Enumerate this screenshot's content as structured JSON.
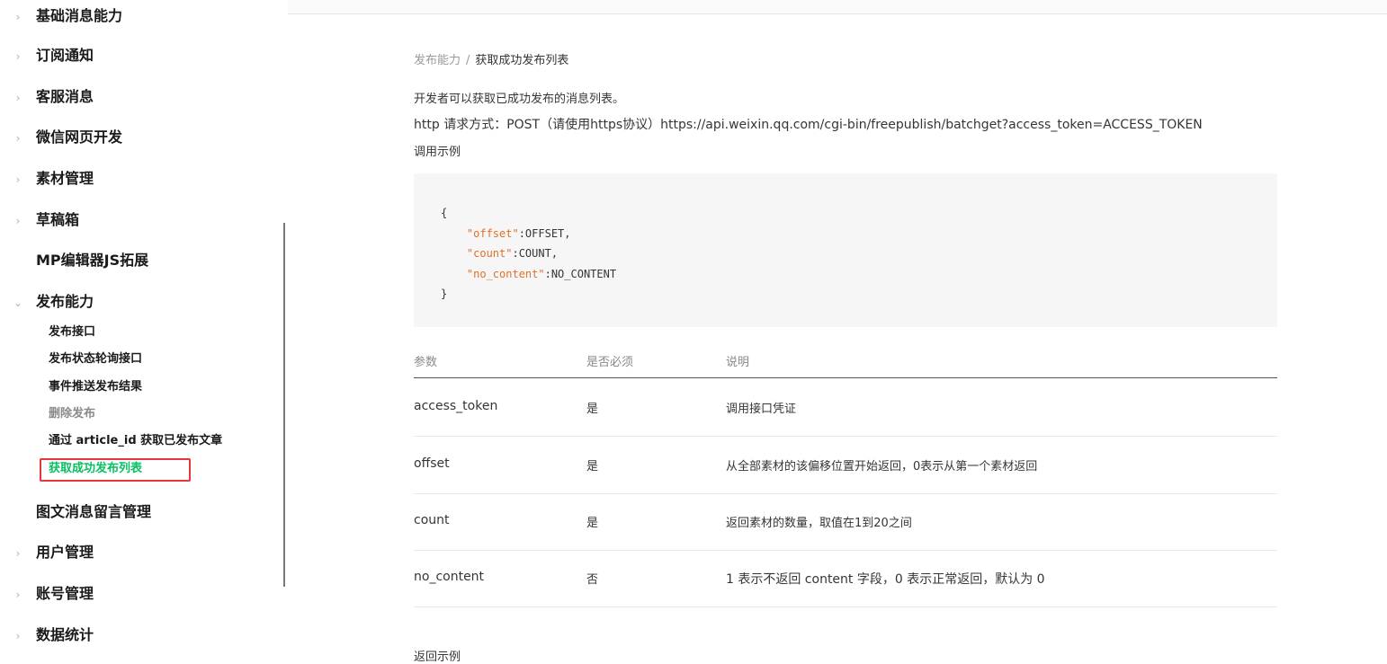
{
  "sidebar": {
    "items": [
      {
        "label": "基础消息能力",
        "chevron": "›"
      },
      {
        "label": "订阅通知",
        "chevron": "›"
      },
      {
        "label": "客服消息",
        "chevron": "›"
      },
      {
        "label": "微信网页开发",
        "chevron": "›"
      },
      {
        "label": "素材管理",
        "chevron": "›"
      },
      {
        "label": "草稿箱",
        "chevron": "›"
      },
      {
        "label": "MP编辑器JS拓展",
        "chevron": ""
      },
      {
        "label": "发布能力",
        "chevron": "⌄"
      }
    ],
    "sub_items": [
      {
        "label": "发布接口"
      },
      {
        "label": "发布状态轮询接口"
      },
      {
        "label": "事件推送发布结果"
      },
      {
        "label": "删除发布"
      },
      {
        "label": "通过 article_id 获取已发布文章"
      },
      {
        "label": "获取成功发布列表"
      }
    ],
    "items_after": [
      {
        "label": "图文消息留言管理",
        "chevron": ""
      },
      {
        "label": "用户管理",
        "chevron": "›"
      },
      {
        "label": "账号管理",
        "chevron": "›"
      },
      {
        "label": "数据统计",
        "chevron": "›"
      }
    ]
  },
  "breadcrumb": {
    "parent": "发布能力",
    "separator": "/",
    "current": "获取成功发布列表"
  },
  "intro": "开发者可以获取已成功发布的消息列表。",
  "http_line": "http 请求方式：POST（请使用https协议）https://api.weixin.qq.com/cgi-bin/freepublish/batchget?access_token=ACCESS_TOKEN",
  "example_label": "调用示例",
  "code": {
    "open": "{",
    "lines": [
      {
        "key": "\"offset\"",
        "rest": ":OFFSET,"
      },
      {
        "key": "\"count\"",
        "rest": ":COUNT,"
      },
      {
        "key": "\"no_content\"",
        "rest": ":NO_CONTENT"
      }
    ],
    "close": "}"
  },
  "table": {
    "headers": [
      "参数",
      "是否必须",
      "说明"
    ],
    "rows": [
      [
        "access_token",
        "是",
        "调用接口凭证"
      ],
      [
        "offset",
        "是",
        "从全部素材的该偏移位置开始返回，0表示从第一个素材返回"
      ],
      [
        "count",
        "是",
        "返回素材的数量，取值在1到20之间"
      ],
      [
        "no_content",
        "否",
        "1 表示不返回 content 字段，0 表示正常返回，默认为 0"
      ]
    ]
  },
  "return_example_label": "返回示例",
  "colors": {
    "active": "#07c160",
    "highlight_box": "#e8373c",
    "code_key": "#e0702c"
  }
}
